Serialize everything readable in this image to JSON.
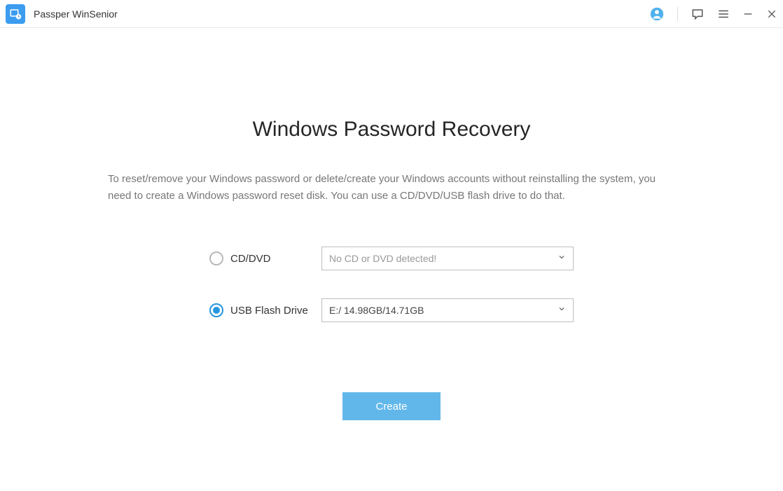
{
  "titlebar": {
    "app_name": "Passper WinSenior"
  },
  "main": {
    "title": "Windows Password Recovery",
    "description": "To reset/remove your Windows password or delete/create your Windows accounts without reinstalling the system, you need to create a Windows password reset disk. You can use a CD/DVD/USB flash drive to do that.",
    "options": {
      "cddvd": {
        "label": "CD/DVD",
        "selected_value": "No CD or DVD detected!",
        "is_selected": false
      },
      "usb": {
        "label": "USB Flash Drive",
        "selected_value": "E:/ 14.98GB/14.71GB",
        "is_selected": true
      }
    },
    "create_button": "Create"
  }
}
